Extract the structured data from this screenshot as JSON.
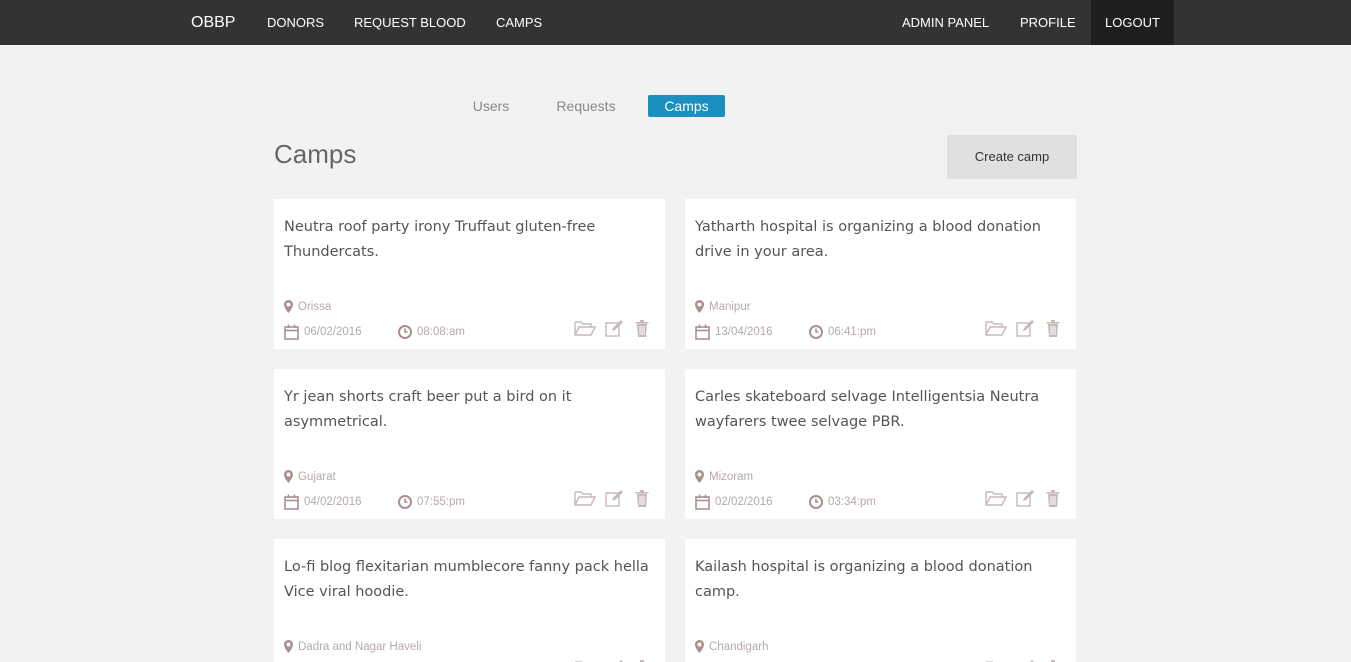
{
  "nav": {
    "brand": "OBBP",
    "left_links": [
      "DONORS",
      "REQUEST BLOOD",
      "CAMPS"
    ],
    "right_links": [
      "ADMIN PANEL",
      "PROFILE",
      "LOGOUT"
    ],
    "active_link": "LOGOUT"
  },
  "tabs": {
    "items": [
      "Users",
      "Requests",
      "Camps"
    ],
    "active": "Camps"
  },
  "page": {
    "title": "Camps",
    "create_button": "Create camp"
  },
  "colors": {
    "navbar": "#333333",
    "accent": "#1a8fc0",
    "background": "#f2f2f2",
    "muted_text": "#b8a8a8"
  },
  "camps": [
    {
      "title": "Neutra roof party irony Truffaut gluten-free Thundercats.",
      "location": "Orissa",
      "date": "06/02/2016",
      "time": "08:08:am"
    },
    {
      "title": "Yatharth hospital is organizing a blood donation drive in your area.",
      "location": "Manipur",
      "date": "13/04/2016",
      "time": "06:41:pm"
    },
    {
      "title": "Yr jean shorts craft beer put a bird on it asymmetrical.",
      "location": "Gujarat",
      "date": "04/02/2016",
      "time": "07:55:pm"
    },
    {
      "title": "Carles skateboard selvage Intelligentsia Neutra wayfarers twee selvage PBR.",
      "location": "Mizoram",
      "date": "02/02/2016",
      "time": "03:34:pm"
    },
    {
      "title": "Lo-fi blog flexitarian mumblecore fanny pack hella Vice viral hoodie.",
      "location": "Dadra and Nagar Haveli",
      "date": "",
      "time": ""
    },
    {
      "title": "Kailash hospital is organizing a blood donation camp.",
      "location": "Chandigarh",
      "date": "",
      "time": ""
    }
  ],
  "icons": {
    "location": "map-marker-icon",
    "date": "calendar-icon",
    "time": "clock-icon",
    "view": "folder-open-icon",
    "edit": "edit-icon",
    "delete": "trash-icon"
  }
}
